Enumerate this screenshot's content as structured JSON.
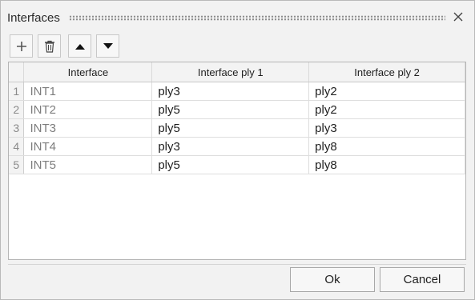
{
  "dialog": {
    "title": "Interfaces"
  },
  "toolbar": {
    "add_icon": "plus-icon",
    "delete_icon": "trash-icon",
    "move_up_icon": "triangle-up-icon",
    "move_down_icon": "triangle-down-icon"
  },
  "table": {
    "columns": [
      "Interface",
      "Interface ply 1",
      "Interface ply 2"
    ],
    "rows": [
      {
        "num": "1",
        "interface": "INT1",
        "ply1": "ply3",
        "ply2": "ply2"
      },
      {
        "num": "2",
        "interface": "INT2",
        "ply1": "ply5",
        "ply2": "ply2"
      },
      {
        "num": "3",
        "interface": "INT3",
        "ply1": "ply5",
        "ply2": "ply3"
      },
      {
        "num": "4",
        "interface": "INT4",
        "ply1": "ply3",
        "ply2": "ply8"
      },
      {
        "num": "5",
        "interface": "INT5",
        "ply1": "ply5",
        "ply2": "ply8"
      }
    ]
  },
  "footer": {
    "ok_label": "Ok",
    "cancel_label": "Cancel"
  },
  "colors": {
    "dialog_bg": "#f2f2f2",
    "row_number_text": "#8a8a8a",
    "interface_name_text": "#7d7d7d"
  }
}
